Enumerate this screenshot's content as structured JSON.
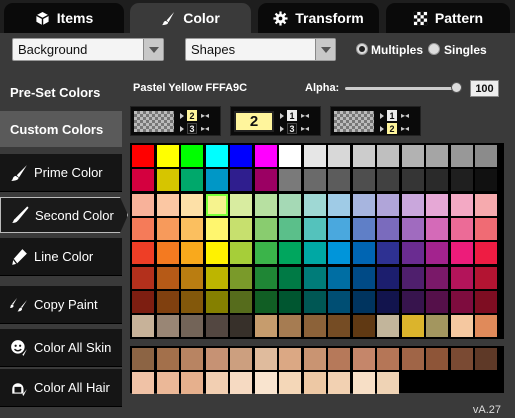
{
  "tabs": [
    {
      "label": "Items",
      "icon": "cube-icon"
    },
    {
      "label": "Color",
      "icon": "paintbrush-icon"
    },
    {
      "label": "Transform",
      "icon": "gear-icon"
    },
    {
      "label": "Pattern",
      "icon": "checker-icon"
    }
  ],
  "dropdowns": {
    "target": "Background",
    "mode": "Shapes"
  },
  "radios": {
    "multiples": "Multiples",
    "singles": "Singles",
    "selected": "Multiples"
  },
  "side": {
    "preset_colors": "Pre-Set Colors",
    "custom_colors": "Custom Colors",
    "buttons": [
      {
        "label": "Prime Color",
        "icon": "paintbrush-icon"
      },
      {
        "label": "Second Color",
        "icon": "brush-icon",
        "selected": true
      },
      {
        "label": "Line Color",
        "icon": "pen-icon"
      },
      {
        "label": "Copy Paint",
        "icon": "copy-paint-icon"
      },
      {
        "label": "Color All Skin",
        "icon": "face-paint-icon"
      },
      {
        "label": "Color All Hair",
        "icon": "hair-paint-icon"
      }
    ]
  },
  "header": {
    "preset_name": "Pastel Yellow FFFA9C",
    "alpha_label": "Alpha:",
    "alpha_value": "100",
    "alpha_level": 1.0
  },
  "slots": [
    {
      "main": "checker",
      "top": "2",
      "bottom": "3"
    },
    {
      "main": "2",
      "top": "1",
      "bottom": "3"
    },
    {
      "main": "checker",
      "top": "1",
      "bottom": "2"
    }
  ],
  "palette": [
    [
      "#ff0000",
      "#ffff00",
      "#00ff00",
      "#00ffff",
      "#0000ff",
      "#ff00ff",
      "#ffffff",
      "#e6e6e6",
      "#d8d8d8",
      "#cccccc",
      "#bfbfbf",
      "#b2b2b2",
      "#a5a5a5",
      "#989898",
      "#8b8b8b"
    ],
    [
      "#d4003f",
      "#d6c500",
      "#00a86b",
      "#0097c6",
      "#2f1e8e",
      "#9b0063",
      "#7a7a7a",
      "#6a6a6a",
      "#5c5c5c",
      "#4e4e4e",
      "#414141",
      "#353535",
      "#2a2a2a",
      "#1f1f1f",
      "#111111"
    ],
    [
      "#f8b29a",
      "#fbc7a3",
      "#fde0a7",
      "#f6f38e",
      "#d8eca0",
      "#b7e0a1",
      "#a5d9b5",
      "#9fd8d4",
      "#9fcbe6",
      "#a7b5df",
      "#b0a5d9",
      "#c9a7dc",
      "#e6a8d6",
      "#f3a9c4",
      "#f6aaae"
    ],
    [
      "#f57b59",
      "#f79a5b",
      "#fbbf5f",
      "#fff66e",
      "#c7e06e",
      "#89cc6f",
      "#5bbf8a",
      "#54c2bc",
      "#4aa8de",
      "#5f7fc7",
      "#7a6bbd",
      "#a06bbf",
      "#d46ab8",
      "#ec6b97",
      "#f06b74"
    ],
    [
      "#ee3e26",
      "#f47a20",
      "#f9a91c",
      "#fff200",
      "#a6ce39",
      "#3bb44a",
      "#00a65e",
      "#00a8a4",
      "#0095da",
      "#0065b3",
      "#2e3192",
      "#6a2c91",
      "#a3238e",
      "#ed1c7a",
      "#ee1c43"
    ],
    [
      "#b3301c",
      "#b65a17",
      "#ba7d11",
      "#bdb500",
      "#7a9a2a",
      "#1f8635",
      "#007a45",
      "#007c79",
      "#006ea3",
      "#004a86",
      "#1c1e6e",
      "#4f1f6d",
      "#7a1969",
      "#b3145a",
      "#b31432"
    ],
    [
      "#7d1e11",
      "#80400f",
      "#83580b",
      "#858000",
      "#566c1c",
      "#115e24",
      "#005630",
      "#005754",
      "#004e73",
      "#00345f",
      "#12144d",
      "#37144d",
      "#55104a",
      "#7e0c3e",
      "#7e0d22"
    ],
    [
      "#c7b299",
      "#998675",
      "#736458",
      "#534741",
      "#37302a",
      "#c69c6d",
      "#a67c52",
      "#8c6239",
      "#754c24",
      "#603913",
      "#c2b59b",
      "#dbb42c",
      "#a3965f",
      "#f5c8a0",
      "#e08a5a"
    ]
  ],
  "palette2": [
    [
      "#8c6444",
      "#a3704b",
      "#b88462",
      "#c69274",
      "#cc9f7f",
      "#dfbb9d",
      "#dba884",
      "#c99472",
      "#b6795a",
      "#c5866a",
      "#b57657",
      "#a06547",
      "#8e5538",
      "#7a4a33",
      "#5e3927"
    ],
    [
      "#f0c2a6",
      "#ebb898",
      "#e6b08d",
      "#f2cfb2",
      "#f6dac2",
      "#f9e4cf",
      "#f4d7b8",
      "#edc8a4",
      "#f2d1b2",
      "#f7dfc6",
      "#efd3b5"
    ]
  ],
  "version": "vA.27"
}
